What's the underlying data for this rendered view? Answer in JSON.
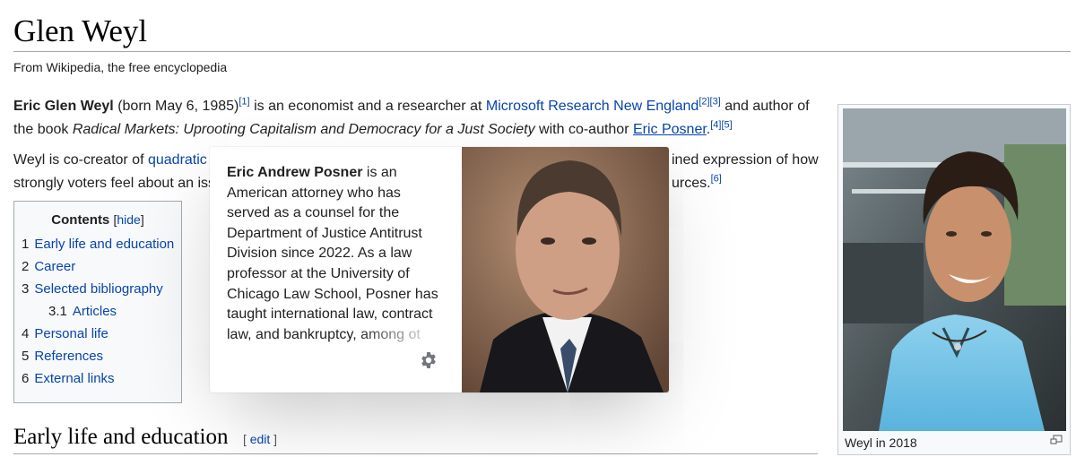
{
  "page": {
    "title": "Glen Weyl",
    "tagline": "From Wikipedia, the free encyclopedia"
  },
  "intro": {
    "name_bold": "Eric Glen Weyl",
    "born": " (born May 6, 1985)",
    "ref1": "[1]",
    "t1": " is an economist and a researcher at ",
    "link_msr": "Microsoft Research New England",
    "ref2": "[2]",
    "ref3": "[3]",
    "t2": " and author of the book ",
    "book": "Radical Markets: Uprooting Capitalism and Democracy for a Just Society",
    "t3": " with co-author ",
    "link_posner": "Eric Posner",
    "t4": ".",
    "ref4": "[4]",
    "ref5": "[5]"
  },
  "para2": {
    "t1": "Weyl is co-creator of ",
    "link_quadratic": "quadratic",
    "right1": "ined expression of how",
    "t2": "strongly voters feel about an iss",
    "right2": "urces.",
    "ref6": "[6]"
  },
  "toc": {
    "title": "Contents",
    "hide_open": "[",
    "hide_label": "hide",
    "hide_close": "]",
    "items": [
      {
        "num": "1",
        "label": "Early life and education"
      },
      {
        "num": "2",
        "label": "Career"
      },
      {
        "num": "3",
        "label": "Selected bibliography"
      },
      {
        "num": "3.1",
        "label": "Articles"
      },
      {
        "num": "4",
        "label": "Personal life"
      },
      {
        "num": "5",
        "label": "References"
      },
      {
        "num": "6",
        "label": "External links"
      }
    ]
  },
  "section": {
    "heading": "Early life and education",
    "edit_open": "[ ",
    "edit_label": "edit",
    "edit_close": " ]"
  },
  "infobox": {
    "caption": "Weyl in 2018",
    "enlarge_icon": "enlarge-icon"
  },
  "popup": {
    "bold": "Eric Andrew Posner",
    "text": " is an American attorney who has served as a counsel for the Department of Justice Antitrust Division since 2022. As a law professor at the University of Chicago Law School, Posner has taught international law, contract law, and bankruptcy, among ot",
    "settings_icon": "gear-icon"
  }
}
